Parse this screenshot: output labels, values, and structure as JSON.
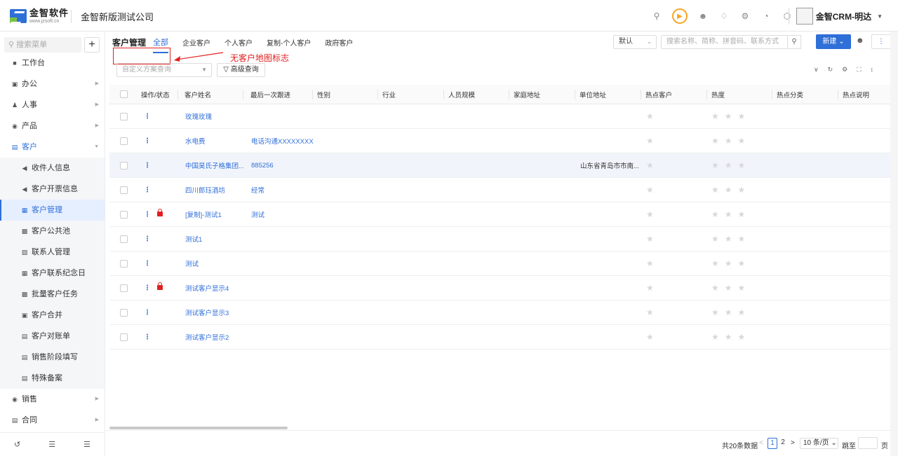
{
  "header": {
    "logo_cn": "金智软件",
    "logo_en": "www.jzsoft.cn",
    "company": "金智新版测试公司",
    "user_name": "金智CRM-明达"
  },
  "sidebar": {
    "search_placeholder": "搜索菜单",
    "plus": "+",
    "items": [
      {
        "label": "工作台",
        "icon": "dashboard-icon"
      },
      {
        "label": "办公",
        "icon": "office-icon"
      },
      {
        "label": "人事",
        "icon": "hr-icon"
      },
      {
        "label": "产品",
        "icon": "product-icon"
      },
      {
        "label": "客户",
        "icon": "customer-icon"
      },
      {
        "label": "收件人信息",
        "icon": "speaker-icon"
      },
      {
        "label": "客户开票信息",
        "icon": "speaker-icon"
      },
      {
        "label": "客户管理",
        "icon": "chart-icon"
      },
      {
        "label": "客户公共池",
        "icon": "pool-icon"
      },
      {
        "label": "联系人管理",
        "icon": "contact-icon"
      },
      {
        "label": "客户联系纪念日",
        "icon": "calendar-icon"
      },
      {
        "label": "批量客户任务",
        "icon": "task-icon"
      },
      {
        "label": "客户合并",
        "icon": "merge-icon"
      },
      {
        "label": "客户对账单",
        "icon": "statement-icon"
      },
      {
        "label": "销售阶段填写",
        "icon": "stage-icon"
      },
      {
        "label": "特殊备案",
        "icon": "record-icon"
      },
      {
        "label": "销售",
        "icon": "sales-icon"
      },
      {
        "label": "合同",
        "icon": "contract-icon"
      }
    ]
  },
  "main": {
    "page_title": "客户管理",
    "tabs": [
      "全部",
      "企业客户",
      "个人客户",
      "复制-个人客户",
      "政府客户"
    ],
    "sort_default": "默认",
    "search_placeholder": "搜索名称、简称、拼音码、联系方式",
    "new_button": "新建",
    "annotation": "无客户地图标志",
    "plan_placeholder": "自定义方案查询",
    "advanced_query": "高级查询"
  },
  "table": {
    "columns": [
      "操作/状态",
      "客户姓名",
      "最后一次跟进",
      "性别",
      "行业",
      "人员规模",
      "家庭地址",
      "单位地址",
      "热点客户",
      "热度",
      "热点分类",
      "热点说明"
    ],
    "rows": [
      {
        "name": "玫瑰玫瑰",
        "followup": "",
        "address": "",
        "locked": false
      },
      {
        "name": "水电费",
        "followup": "电话沟通XXXXXXXX",
        "address": "",
        "locked": false
      },
      {
        "name": "中国昊氏子格集团...",
        "followup": "885256",
        "address": "山东省青岛市市南...",
        "locked": false
      },
      {
        "name": "四川郎珏酒坊",
        "followup": "经常",
        "address": "",
        "locked": false
      },
      {
        "name": "[复制]-测试1",
        "followup": "测试",
        "address": "",
        "locked": true
      },
      {
        "name": "测试1",
        "followup": "",
        "address": "",
        "locked": false
      },
      {
        "name": "测试",
        "followup": "",
        "address": "",
        "locked": false
      },
      {
        "name": "测试客户显示4",
        "followup": "",
        "address": "",
        "locked": true
      },
      {
        "name": "测试客户显示3",
        "followup": "",
        "address": "",
        "locked": false
      },
      {
        "name": "测试客户显示2",
        "followup": "",
        "address": "",
        "locked": false
      }
    ]
  },
  "pager": {
    "total": "共20条数据",
    "pages": [
      "1",
      "2"
    ],
    "page_size": "10 条/页",
    "jump_label": "跳至",
    "page_suffix": "页"
  },
  "colors": {
    "accent": "#2f6fd8",
    "annotation": "#e02020",
    "warning": "#f5a623"
  }
}
